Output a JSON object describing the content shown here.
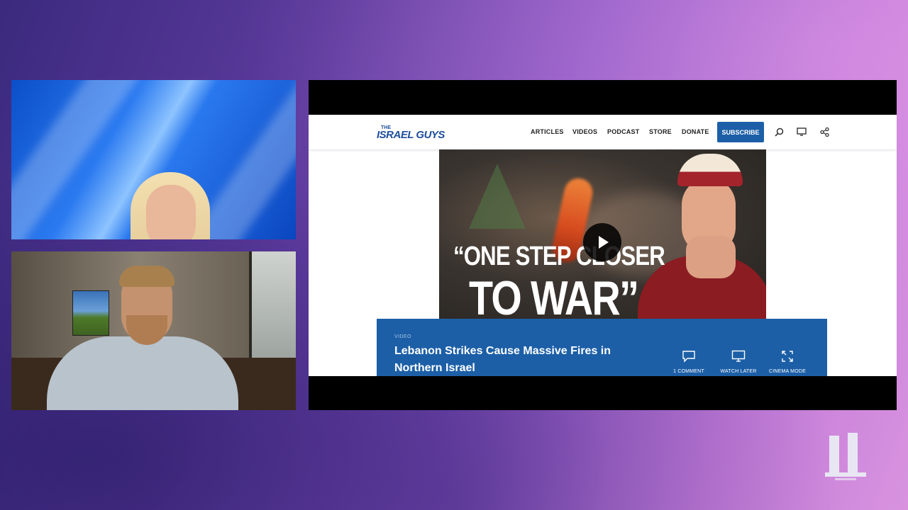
{
  "site": {
    "logo_small": "THE",
    "logo_name": "ISRAEL GUYS",
    "nav": [
      "ARTICLES",
      "VIDEOS",
      "PODCAST",
      "STORE",
      "DONATE"
    ],
    "subscribe_label": "SUBSCRIBE",
    "icons": [
      "search-icon",
      "monitor-icon",
      "share-icon"
    ]
  },
  "video": {
    "category": "VIDEO",
    "title": "Lebanon Strikes Cause Massive Fires in Northern Israel",
    "thumbnail_line1": "“ONE STEP CLOSER",
    "thumbnail_line2": "TO WAR”",
    "actions": [
      {
        "icon": "comment-icon",
        "label": "1 COMMENT"
      },
      {
        "icon": "watch-later-icon",
        "label": "WATCH LATER"
      },
      {
        "icon": "cinema-mode-icon",
        "label": "CINEMA MODE"
      }
    ]
  },
  "colors": {
    "accent": "#1c5fa7",
    "background_left": "#3b2a7e",
    "background_right": "#d893df"
  }
}
